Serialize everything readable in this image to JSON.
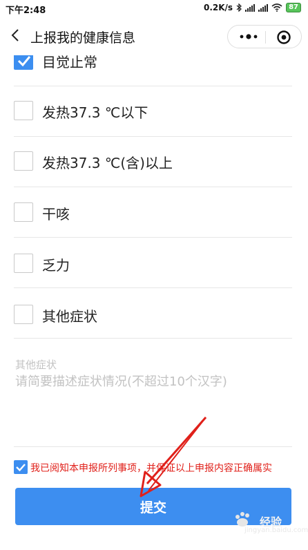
{
  "status_bar": {
    "time": "下午2:48",
    "speed": "0.2K/s",
    "battery": "87",
    "icons": [
      "bluetooth-icon",
      "signal-icon",
      "signal-icon",
      "wifi-icon",
      "battery-icon"
    ]
  },
  "nav": {
    "title": "上报我的健康信息",
    "back_icon": "chevron-left-icon",
    "more_icon": "more-dots-icon",
    "close_icon": "target-close-icon"
  },
  "symptoms": [
    {
      "label": "目觉止常",
      "checked": true
    },
    {
      "label": "发热37.3 ℃以下",
      "checked": false
    },
    {
      "label": "发热37.3 ℃(含)以上",
      "checked": false
    },
    {
      "label": "干咳",
      "checked": false
    },
    {
      "label": "乏力",
      "checked": false
    },
    {
      "label": "其他症状",
      "checked": false
    }
  ],
  "other_symptoms": {
    "label": "其他症状",
    "placeholder": "请简要描述症状情况(不超过10个汉字)",
    "value": ""
  },
  "agreement": {
    "checked": true,
    "text": "我已阅知本申报所列事项，并保证以上申报内容正确属实"
  },
  "submit": {
    "label": "提交"
  },
  "accent_color": "#3d8ef0",
  "warning_color": "#e0201a",
  "watermark": {
    "text": "经验",
    "url": "jingyan.baidu.com"
  }
}
